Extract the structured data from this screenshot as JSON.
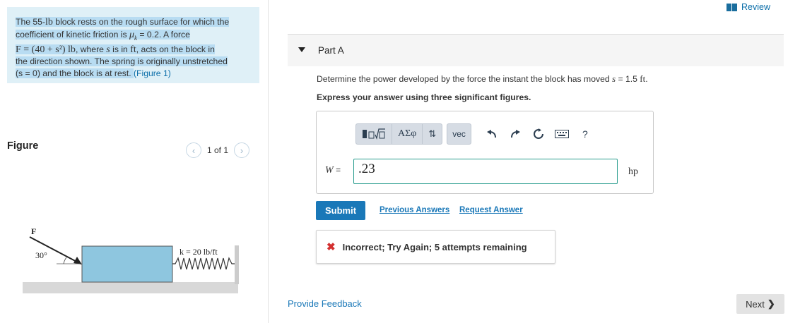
{
  "problem": {
    "line1": "The 55-",
    "lb": "lb",
    "line1b": " block rests on the rough surface for which the",
    "line2a": "coefficient of kinetic friction is ",
    "mu": "μ",
    "mu_sub": "k",
    "line2b": " = 0.2. A force",
    "force_expr": "F = (40 + s²) lb",
    "line3b": ", where ",
    "s": "s",
    "line3c": " is in ",
    "ft": "ft",
    "line3d": ", acts on the block in",
    "line4": "the direction shown. The spring is originally unstretched",
    "line5a": "(s = 0) and the block is at rest. ",
    "figure_link": "(Figure 1)"
  },
  "figure_section": {
    "label": "Figure",
    "pager": "1 of 1",
    "prev_icon": "chevron-left-icon",
    "next_icon": "chevron-right-icon"
  },
  "figure": {
    "force_label": "F",
    "angle_label": "30°",
    "spring_label": "k = 20 lb/ft"
  },
  "header": {
    "review": "Review"
  },
  "part": {
    "title": "Part A"
  },
  "question": {
    "text_a": "Determine the power developed by the force the instant the block has moved ",
    "s": "s",
    "text_b": " = 1.5 ",
    "ft": "ft",
    "text_c": ".",
    "instruction": "Express your answer using three significant figures."
  },
  "toolbar": {
    "templates": "templates-icon",
    "greek": "ΑΣφ",
    "arrows": "⇅",
    "vec": "vec",
    "undo": "undo-icon",
    "redo": "redo-icon",
    "reset": "reset-icon",
    "keyboard": "keyboard-icon",
    "help": "?"
  },
  "answer": {
    "var": "W",
    "eq": "=",
    "value": ".23",
    "unit": "hp"
  },
  "actions": {
    "submit": "Submit",
    "previous_answers": "Previous Answers",
    "request_answer": "Request Answer"
  },
  "feedback": {
    "text": "Incorrect; Try Again; 5 attempts remaining"
  },
  "footer": {
    "provide_feedback": "Provide Feedback",
    "next": "Next"
  }
}
